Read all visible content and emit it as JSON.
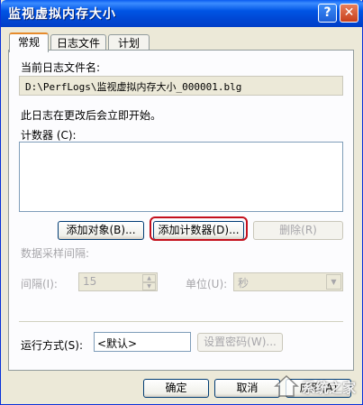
{
  "window": {
    "title": "监视虚拟内存大小",
    "help_glyph": "?",
    "close_glyph": "✕"
  },
  "tabs": [
    {
      "label": "常规"
    },
    {
      "label": "日志文件"
    },
    {
      "label": "计划"
    }
  ],
  "general": {
    "current_log_label": "当前日志文件名:",
    "current_log_value": "D:\\PerfLogs\\监视虚拟内存大小_000001.blg",
    "start_info": "此日志在更改后会立即开始。",
    "counters_label": "计数器 (C):",
    "add_objects_button": "添加对象(B)...",
    "add_counters_button": "添加计数器(D)...",
    "remove_button": "删除(R)",
    "sample_interval_label": "数据采样间隔:",
    "interval_label": "间隔(I):",
    "interval_value": "15",
    "units_label": "单位(U):",
    "units_value": "秒",
    "run_as_label": "运行方式(S):",
    "run_as_value": "<默认>",
    "set_password_button": "设置密码(W)..."
  },
  "footer": {
    "ok_button": "确定",
    "cancel_button": "取消",
    "apply_button": "应用(A)"
  },
  "watermark": {
    "text": "系统之家"
  }
}
